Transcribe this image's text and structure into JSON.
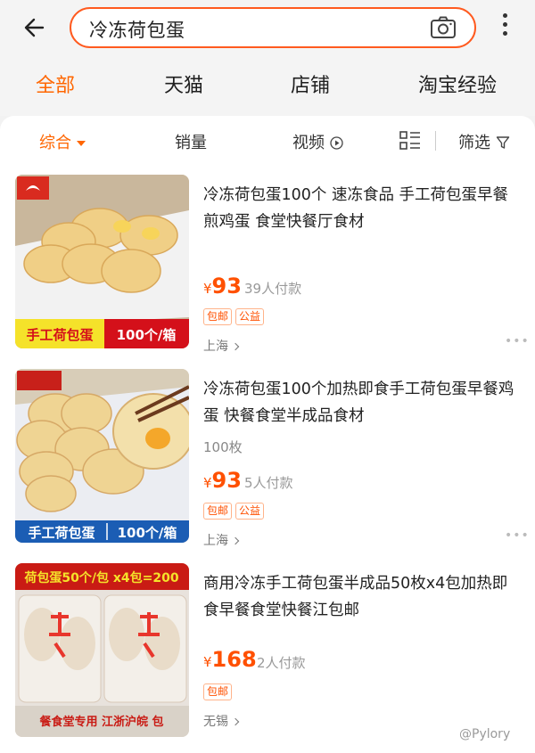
{
  "search": {
    "query": "冷冻荷包蛋"
  },
  "tabs": [
    "全部",
    "天猫",
    "店铺",
    "淘宝经验"
  ],
  "filters": {
    "comprehensive": "综合",
    "sales": "销量",
    "video": "视频",
    "filter": "筛选"
  },
  "products": [
    {
      "title": "冷冻荷包蛋100个 速冻食品 手工荷包蛋早餐煎鸡蛋 食堂快餐厅食材",
      "spec": "",
      "price_symbol": "¥",
      "price": "93",
      "sold": "39人付款",
      "tags": [
        "包邮",
        "公益"
      ],
      "location": "上海",
      "banner_left": "手工荷包蛋",
      "banner_right": "100个/箱"
    },
    {
      "title": "冷冻荷包蛋100个加热即食手工荷包蛋早餐鸡蛋 快餐食堂半成品食材",
      "spec": "100枚",
      "price_symbol": "¥",
      "price": "93",
      "sold": "5人付款",
      "tags": [
        "包邮",
        "公益"
      ],
      "location": "上海",
      "banner_left": "手工荷包蛋",
      "banner_right": "100个/箱"
    },
    {
      "title": "商用冷冻手工荷包蛋半成品50枚x4包加热即食早餐食堂快餐江包邮",
      "spec": "",
      "price_symbol": "¥",
      "price": "168",
      "sold": "2人付款",
      "tags": [
        "包邮"
      ],
      "location": "无锡",
      "banner_top": "荷包蛋50个/包 x4包=200",
      "banner_bottom": "餐食堂专用 江浙沪皖 包"
    }
  ],
  "watermark": "@Pylory",
  "colors": {
    "accent": "#ff6600",
    "price": "#ff5000",
    "search_border": "#ff5a1f"
  }
}
